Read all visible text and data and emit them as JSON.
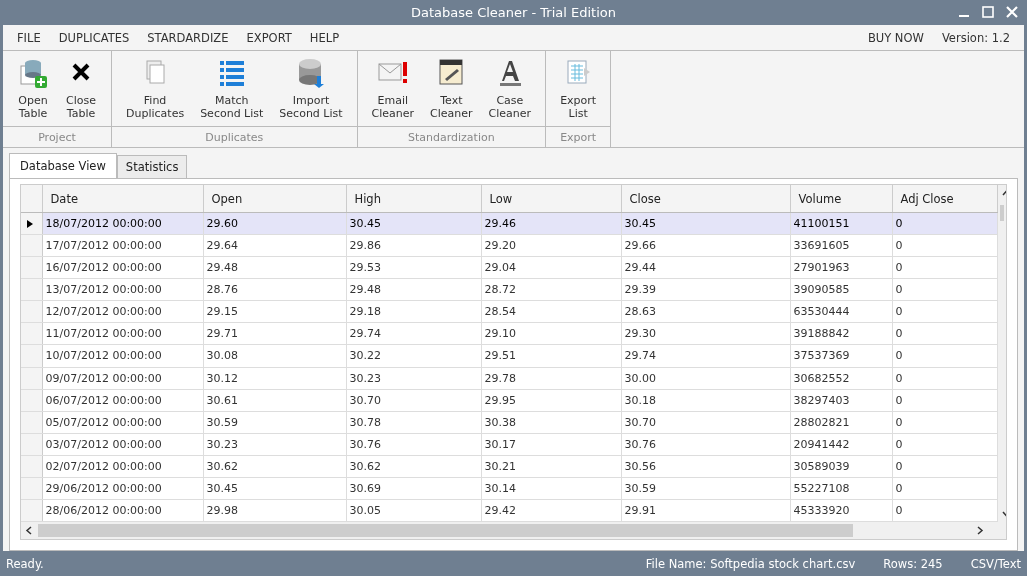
{
  "window": {
    "title": "Database Cleaner - Trial Edition"
  },
  "menu": {
    "items": [
      "FILE",
      "DUPLICATES",
      "STARDARDIZE",
      "EXPORT",
      "HELP"
    ],
    "right": [
      "BUY NOW",
      "Version: 1.2"
    ]
  },
  "ribbon": {
    "groups": [
      {
        "label": "Project",
        "buttons": [
          {
            "label": "Open\nTable"
          },
          {
            "label": "Close\nTable"
          }
        ]
      },
      {
        "label": "Duplicates",
        "buttons": [
          {
            "label": "Find\nDuplicates"
          },
          {
            "label": "Match\nSecond List"
          },
          {
            "label": "Import\nSecond List"
          }
        ]
      },
      {
        "label": "Standardization",
        "buttons": [
          {
            "label": "Email\nCleaner"
          },
          {
            "label": "Text\nCleaner"
          },
          {
            "label": "Case\nCleaner"
          }
        ]
      },
      {
        "label": "Export",
        "buttons": [
          {
            "label": "Export\nList"
          }
        ]
      }
    ]
  },
  "tabs": [
    {
      "label": "Database View",
      "selected": true
    },
    {
      "label": "Statistics",
      "selected": false
    }
  ],
  "table": {
    "columns": [
      "Date",
      "Open",
      "High",
      "Low",
      "Close",
      "Volume",
      "Adj Close"
    ],
    "rows": [
      {
        "selected": true,
        "cells": [
          "18/07/2012 00:00:00",
          "29.60",
          "30.45",
          "29.46",
          "30.45",
          "41100151",
          "0"
        ]
      },
      {
        "selected": false,
        "cells": [
          "17/07/2012 00:00:00",
          "29.64",
          "29.86",
          "29.20",
          "29.66",
          "33691605",
          "0"
        ]
      },
      {
        "selected": false,
        "cells": [
          "16/07/2012 00:00:00",
          "29.48",
          "29.53",
          "29.04",
          "29.44",
          "27901963",
          "0"
        ]
      },
      {
        "selected": false,
        "cells": [
          "13/07/2012 00:00:00",
          "28.76",
          "29.48",
          "28.72",
          "29.39",
          "39090585",
          "0"
        ]
      },
      {
        "selected": false,
        "cells": [
          "12/07/2012 00:00:00",
          "29.15",
          "29.18",
          "28.54",
          "28.63",
          "63530444",
          "0"
        ]
      },
      {
        "selected": false,
        "cells": [
          "11/07/2012 00:00:00",
          "29.71",
          "29.74",
          "29.10",
          "29.30",
          "39188842",
          "0"
        ]
      },
      {
        "selected": false,
        "cells": [
          "10/07/2012 00:00:00",
          "30.08",
          "30.22",
          "29.51",
          "29.74",
          "37537369",
          "0"
        ]
      },
      {
        "selected": false,
        "cells": [
          "09/07/2012 00:00:00",
          "30.12",
          "30.23",
          "29.78",
          "30.00",
          "30682552",
          "0"
        ]
      },
      {
        "selected": false,
        "cells": [
          "06/07/2012 00:00:00",
          "30.61",
          "30.70",
          "29.95",
          "30.18",
          "38297403",
          "0"
        ]
      },
      {
        "selected": false,
        "cells": [
          "05/07/2012 00:00:00",
          "30.59",
          "30.78",
          "30.38",
          "30.70",
          "28802821",
          "0"
        ]
      },
      {
        "selected": false,
        "cells": [
          "03/07/2012 00:00:00",
          "30.23",
          "30.76",
          "30.17",
          "30.76",
          "20941442",
          "0"
        ]
      },
      {
        "selected": false,
        "cells": [
          "02/07/2012 00:00:00",
          "30.62",
          "30.62",
          "30.21",
          "30.56",
          "30589039",
          "0"
        ]
      },
      {
        "selected": false,
        "cells": [
          "29/06/2012 00:00:00",
          "30.45",
          "30.69",
          "30.14",
          "30.59",
          "55227108",
          "0"
        ]
      },
      {
        "selected": false,
        "cells": [
          "28/06/2012 00:00:00",
          "29.98",
          "30.05",
          "29.42",
          "29.91",
          "45333920",
          "0"
        ]
      }
    ]
  },
  "status_bar": {
    "left": "Ready.",
    "right": [
      "File Name: Softpedia stock chart.csv",
      "Rows: 245",
      "CSV/Text"
    ]
  }
}
